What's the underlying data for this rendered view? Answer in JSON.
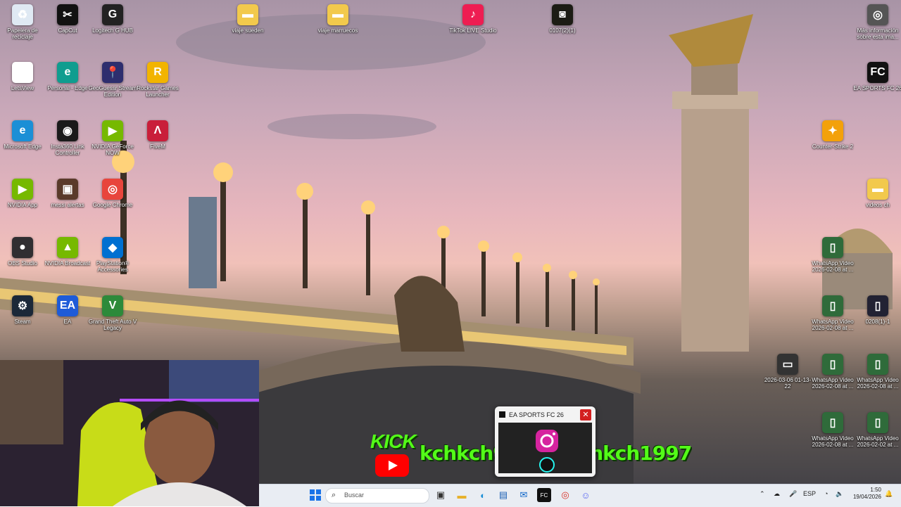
{
  "desktop": {
    "icons_left": [
      {
        "label": "Papelera de reciclaje",
        "glyph": "♻",
        "color": "#dfe9f3"
      },
      {
        "label": "CapCut",
        "glyph": "✂",
        "color": "#111111"
      },
      {
        "label": "Logitech G HUB",
        "glyph": "G",
        "color": "#222222"
      },
      {
        "label": "LetsView",
        "glyph": "◈",
        "color": "#ffffff"
      },
      {
        "label": "Personal - Edge",
        "glyph": "e",
        "color": "#0f9d8f"
      },
      {
        "label": "GeoGuessr Stream Edition",
        "glyph": "📍",
        "color": "#2e2e6e"
      },
      {
        "label": "Rockstar Games Launcher",
        "glyph": "R",
        "color": "#f2b400"
      },
      {
        "label": "Microsoft Edge",
        "glyph": "e",
        "color": "#1b8fd6"
      },
      {
        "label": "Insta360 Link Controller",
        "glyph": "◉",
        "color": "#1a1a1a"
      },
      {
        "label": "NVIDIA GeForce NOW",
        "glyph": "▶",
        "color": "#76b900"
      },
      {
        "label": "FiveM",
        "glyph": "Λ",
        "color": "#c91e3a"
      },
      {
        "label": "NVIDIA App",
        "glyph": "▶",
        "color": "#76b900"
      },
      {
        "label": "messi alertas",
        "glyph": "▣",
        "color": "#5a3a2a"
      },
      {
        "label": "Google Chrome",
        "glyph": "◎",
        "color": "#e8453c"
      },
      {
        "label": "OBS Studio",
        "glyph": "●",
        "color": "#302e31"
      },
      {
        "label": "NVIDIA Broadcast",
        "glyph": "▲",
        "color": "#76b900"
      },
      {
        "label": "PlayStation® Accessories",
        "glyph": "◆",
        "color": "#0070d1"
      },
      {
        "label": "Steam",
        "glyph": "⚙",
        "color": "#1b2838"
      },
      {
        "label": "EA",
        "glyph": "EA",
        "color": "#1e5bd8"
      },
      {
        "label": "Grand Theft Auto V Legacy",
        "glyph": "V",
        "color": "#2d8a3a"
      }
    ],
    "icons_top": [
      {
        "label": "viaje sueden",
        "glyph": "▬",
        "color": "#f2c94c"
      },
      {
        "label": "viaje marruecos",
        "glyph": "▬",
        "color": "#f2c94c"
      },
      {
        "label": "TikTok LIVE Studio",
        "glyph": "♪",
        "color": "#ee1d52"
      },
      {
        "label": "0107(2)(1)",
        "glyph": "◙",
        "color": "#1c1c14"
      }
    ],
    "icons_right": [
      {
        "label": "Más información sobre esta ima...",
        "glyph": "◎",
        "color": "#555555"
      },
      {
        "label": "EA SPORTS FC 26",
        "glyph": "FC",
        "color": "#111111"
      },
      {
        "label": "Counter-Strike 2",
        "glyph": "✦",
        "color": "#f3a10a"
      },
      {
        "label": "videos ch",
        "glyph": "▬",
        "color": "#f2c94c"
      },
      {
        "label": "WhatsApp Video 2026-02-08 at ...",
        "glyph": "▯",
        "color": "#2f6b3a"
      },
      {
        "label": "WhatsApp Video 2026-02-08 at ...",
        "glyph": "▯",
        "color": "#2f6b3a"
      },
      {
        "label": "0208(1)-1",
        "glyph": "▯",
        "color": "#223"
      },
      {
        "label": "2026-03-06 01-13-22",
        "glyph": "▭",
        "color": "#333"
      },
      {
        "label": "WhatsApp Video 2026-02-08 at ...",
        "glyph": "▯",
        "color": "#2f6b3a"
      },
      {
        "label": "WhatsApp Video 2026-02-08 at ...",
        "glyph": "▯",
        "color": "#2f6b3a"
      },
      {
        "label": "WhatsApp Video 2026-02-08 at ...",
        "glyph": "▯",
        "color": "#2f6b3a"
      },
      {
        "label": "WhatsApp Video 2026-02-02 at ...",
        "glyph": "▯",
        "color": "#2f6b3a"
      }
    ]
  },
  "overlay": {
    "kick_label": "KICK",
    "handle_1": "kchkch97",
    "handle_2": "kchkch1997"
  },
  "popup": {
    "title": "EA SPORTS FC 26",
    "close_glyph": "✕"
  },
  "taskbar": {
    "search_placeholder": "Buscar",
    "language": "ESP",
    "time": "1:50",
    "date": "19/04/2026",
    "icons": [
      "start-icon",
      "task-view-icon",
      "file-explorer-icon",
      "edge-icon",
      "store-icon",
      "outlook-icon",
      "ea-fc-icon",
      "chrome-icon",
      "discord-icon"
    ]
  }
}
